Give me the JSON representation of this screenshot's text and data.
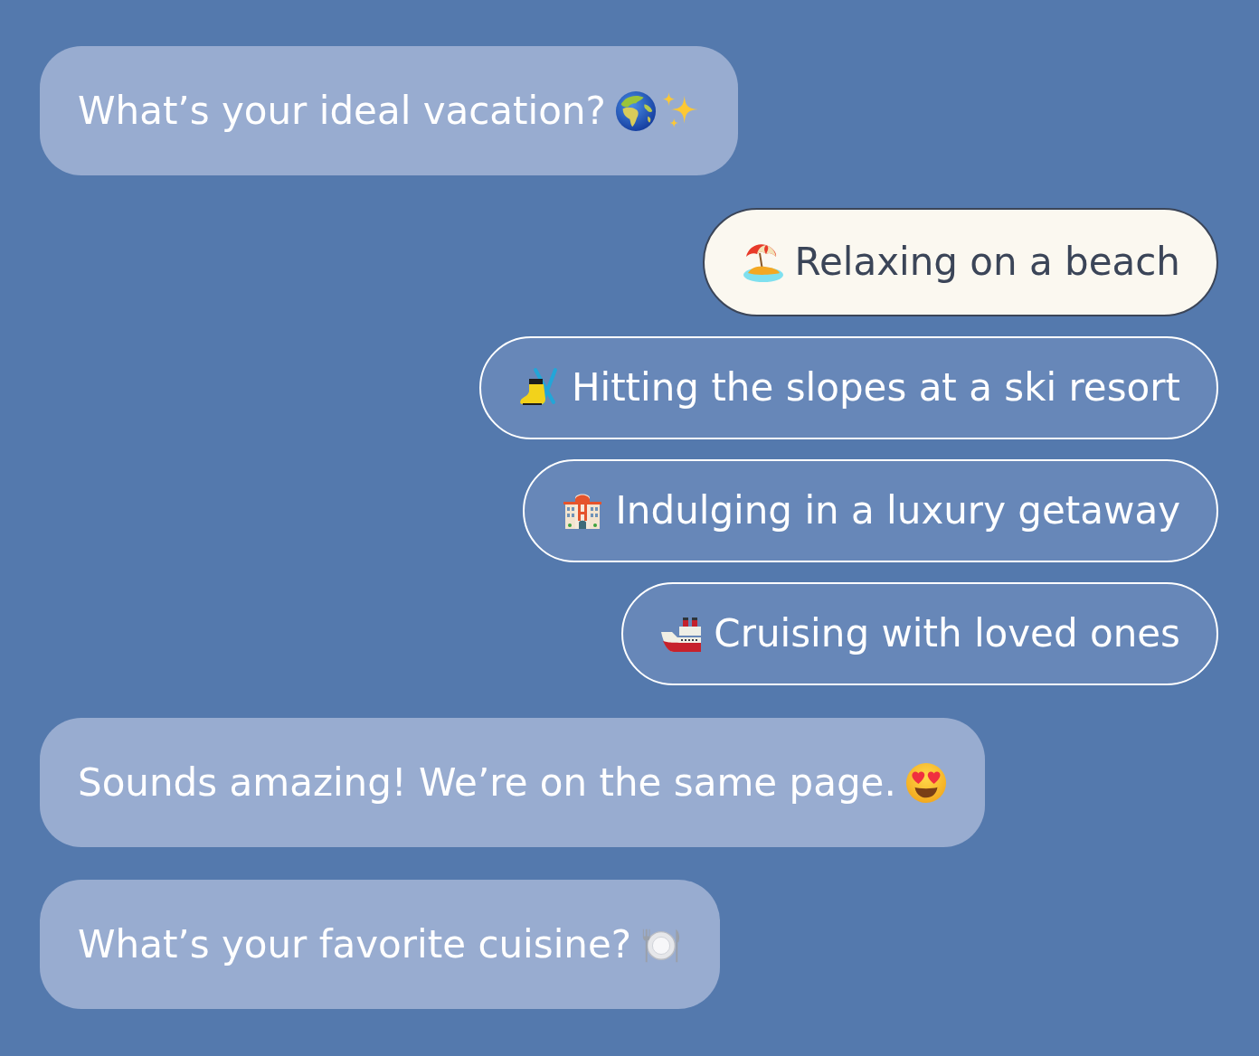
{
  "messages": [
    {
      "kind": "bot",
      "text": "What’s your ideal vacation?"
    },
    {
      "kind": "options",
      "options": [
        {
          "text": "Relaxing on a beach",
          "selected": true
        },
        {
          "text": "Hitting the slopes at a ski resort",
          "selected": false
        },
        {
          "text": "Indulging in a luxury getaway",
          "selected": false
        },
        {
          "text": "Cruising with loved ones",
          "selected": false
        }
      ]
    },
    {
      "kind": "bot",
      "text": "Sounds amazing! We’re on the same page."
    },
    {
      "kind": "bot",
      "text": "What’s your favorite cuisine?"
    }
  ]
}
